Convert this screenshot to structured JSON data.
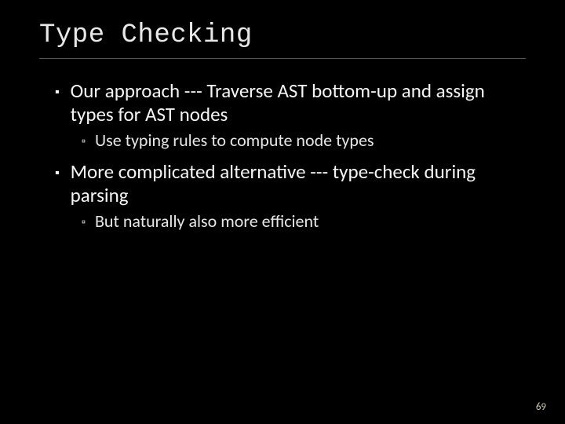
{
  "slide": {
    "title": "Type Checking",
    "bullets": [
      {
        "text": "Our approach --- Traverse AST bottom-up and assign types for AST nodes",
        "sub": [
          {
            "text": "Use typing rules to compute node types"
          }
        ]
      },
      {
        "text": "More complicated alternative --- type-check during parsing",
        "sub": [
          {
            "text": "But naturally also more efficient"
          }
        ]
      }
    ],
    "page_number": "69"
  }
}
